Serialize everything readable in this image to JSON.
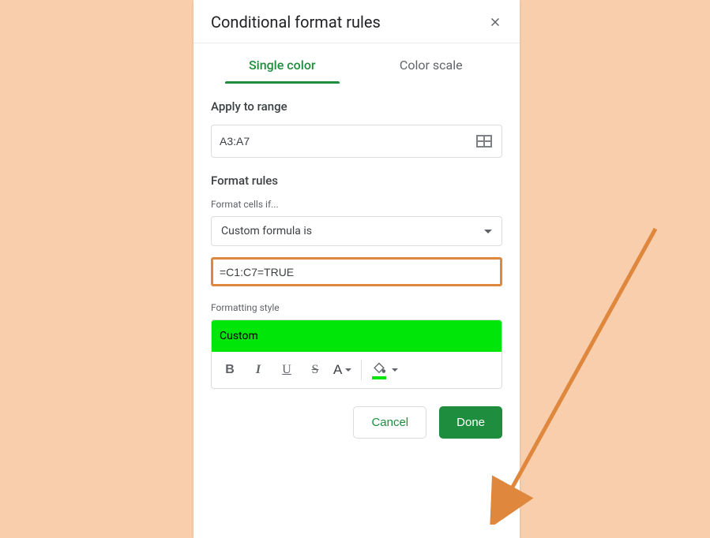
{
  "panel": {
    "title": "Conditional format rules"
  },
  "tabs": {
    "single": "Single color",
    "scale": "Color scale"
  },
  "range": {
    "label": "Apply to range",
    "value": "A3:A7"
  },
  "rules": {
    "label": "Format rules",
    "sublabel": "Format cells if...",
    "condition": "Custom formula is",
    "formula": "=C1:C7=TRUE"
  },
  "style": {
    "label": "Formatting style",
    "preview": "Custom",
    "letter": "A"
  },
  "buttons": {
    "cancel": "Cancel",
    "done": "Done"
  }
}
